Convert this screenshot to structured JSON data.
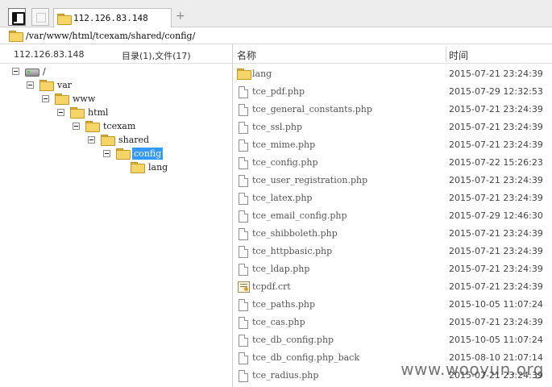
{
  "tab": {
    "title": "112.126.83.148",
    "new_tab": "+"
  },
  "path": "/var/www/html/tcexam/shared/config/",
  "left_header": {
    "host": "112.126.83.148",
    "summary": "目录(1),文件(17)"
  },
  "tree": [
    {
      "label": "/",
      "icon": "drive-icon",
      "selected": false
    },
    {
      "label": "var",
      "icon": "folder-icon",
      "selected": false
    },
    {
      "label": "www",
      "icon": "folder-icon",
      "selected": false
    },
    {
      "label": "html",
      "icon": "folder-icon",
      "selected": false
    },
    {
      "label": "tcexam",
      "icon": "folder-icon",
      "selected": false
    },
    {
      "label": "shared",
      "icon": "folder-icon",
      "selected": false
    },
    {
      "label": "config",
      "icon": "folder-icon",
      "selected": true
    },
    {
      "label": "lang",
      "icon": "folder-icon",
      "selected": false
    }
  ],
  "columns": {
    "name": "名称",
    "time": "时间"
  },
  "files": [
    {
      "name": "lang",
      "time": "2015-07-21 23:24:39",
      "icon": "folder-icon"
    },
    {
      "name": "tce_pdf.php",
      "time": "2015-07-29 12:32:53",
      "icon": "file-icon"
    },
    {
      "name": "tce_general_constants.php",
      "time": "2015-07-21 23:24:39",
      "icon": "file-icon"
    },
    {
      "name": "tce_ssl.php",
      "time": "2015-07-21 23:24:39",
      "icon": "file-icon"
    },
    {
      "name": "tce_mime.php",
      "time": "2015-07-21 23:24:39",
      "icon": "file-icon"
    },
    {
      "name": "tce_config.php",
      "time": "2015-07-22 15:26:23",
      "icon": "file-icon"
    },
    {
      "name": "tce_user_registration.php",
      "time": "2015-07-21 23:24:39",
      "icon": "file-icon"
    },
    {
      "name": "tce_latex.php",
      "time": "2015-07-21 23:24:39",
      "icon": "file-icon"
    },
    {
      "name": "tce_email_config.php",
      "time": "2015-07-29 12:46:30",
      "icon": "file-icon"
    },
    {
      "name": "tce_shibboleth.php",
      "time": "2015-07-21 23:24:39",
      "icon": "file-icon"
    },
    {
      "name": "tce_httpbasic.php",
      "time": "2015-07-21 23:24:39",
      "icon": "file-icon"
    },
    {
      "name": "tce_ldap.php",
      "time": "2015-07-21 23:24:39",
      "icon": "file-icon"
    },
    {
      "name": "tcpdf.crt",
      "time": "2015-07-21 23:24:39",
      "icon": "certificate-icon"
    },
    {
      "name": "tce_paths.php",
      "time": "2015-10-05 11:07:24",
      "icon": "file-icon"
    },
    {
      "name": "tce_cas.php",
      "time": "2015-07-21 23:24:39",
      "icon": "file-icon"
    },
    {
      "name": "tce_db_config.php",
      "time": "2015-10-05 11:07:24",
      "icon": "file-icon"
    },
    {
      "name": "tce_db_config.php_back",
      "time": "2015-08-10 21:07:14",
      "icon": "file-icon"
    },
    {
      "name": "tce_radius.php",
      "time": "2015-07-21 23:24:39",
      "icon": "file-icon"
    }
  ],
  "watermark": "www.wooyun.org",
  "colors": {
    "selection": "#3399ff",
    "folder": "#f7d468"
  }
}
